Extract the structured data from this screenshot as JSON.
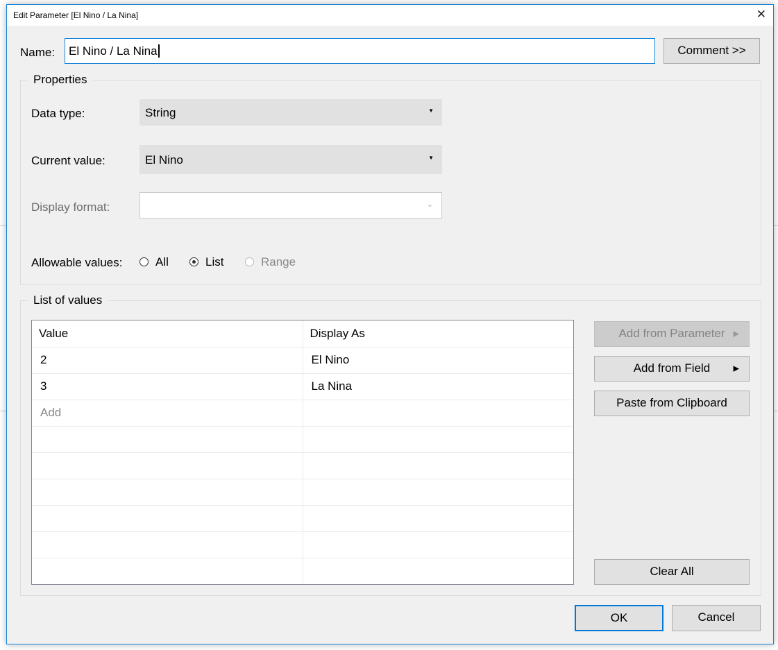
{
  "window": {
    "title": "Edit Parameter [El Nino / La Nina]"
  },
  "name": {
    "label": "Name:",
    "value": "El Nino / La Nina"
  },
  "comment_button": "Comment >>",
  "properties": {
    "title": "Properties",
    "data_type": {
      "label": "Data type:",
      "value": "String"
    },
    "current_value": {
      "label": "Current value:",
      "value": "El Nino"
    },
    "display_format": {
      "label": "Display format:",
      "value": ""
    },
    "allowable": {
      "label": "Allowable values:",
      "options": [
        {
          "label": "All",
          "selected": false
        },
        {
          "label": "List",
          "selected": true
        },
        {
          "label": "Range",
          "selected": false,
          "disabled": true
        }
      ]
    }
  },
  "list": {
    "title": "List of values",
    "headers": [
      "Value",
      "Display As"
    ],
    "rows": [
      [
        "2",
        "El Nino"
      ],
      [
        "3",
        "La Nina"
      ]
    ],
    "add_placeholder": "Add"
  },
  "buttons": {
    "add_from_parameter": "Add from Parameter",
    "add_from_field": "Add from Field",
    "paste": "Paste from Clipboard",
    "clear_all": "Clear All",
    "ok": "OK",
    "cancel": "Cancel"
  }
}
